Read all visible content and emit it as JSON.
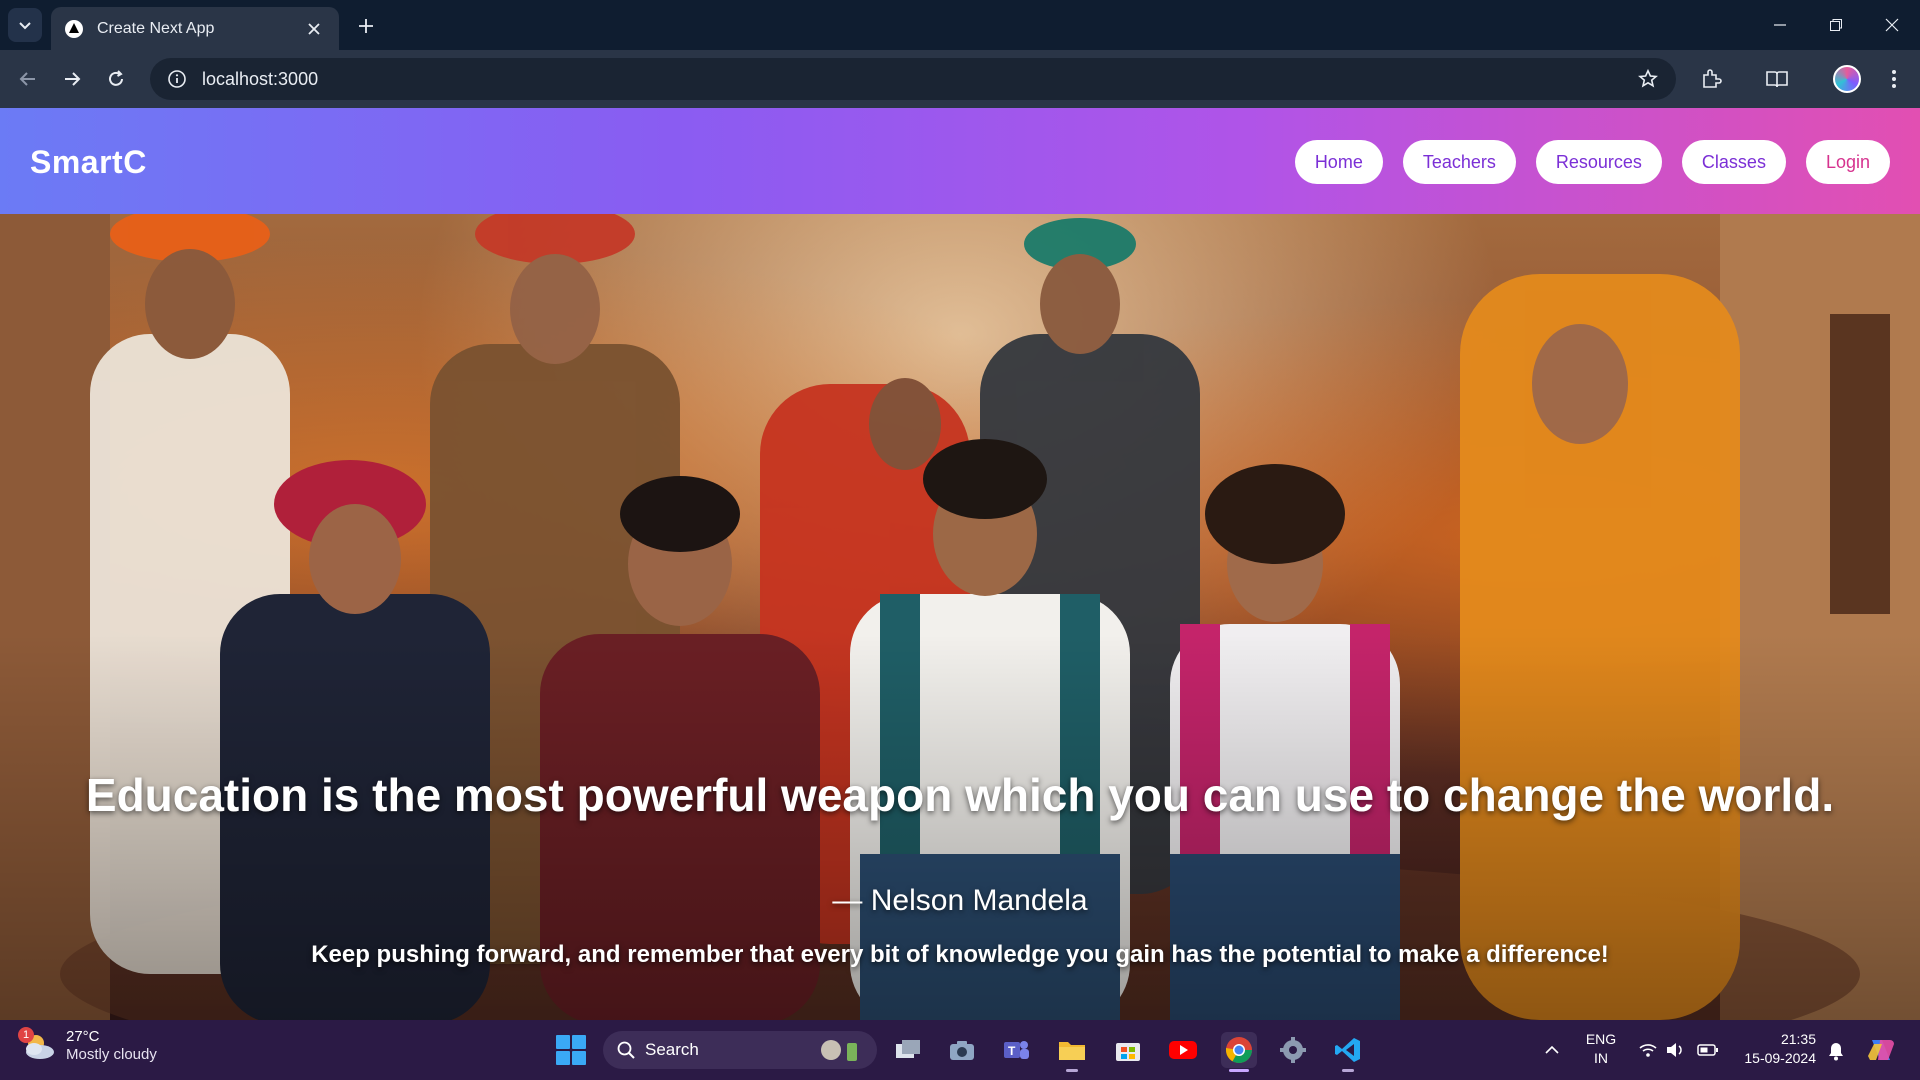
{
  "browser": {
    "tab_title": "Create Next App",
    "url": "localhost:3000"
  },
  "site": {
    "brand": "SmartC",
    "nav": [
      {
        "label": "Home"
      },
      {
        "label": "Teachers"
      },
      {
        "label": "Resources"
      },
      {
        "label": "Classes"
      },
      {
        "label": "Login"
      }
    ]
  },
  "hero": {
    "quote": "Education is the most powerful weapon which you can use to change the world.",
    "author": "— Nelson Mandela",
    "message": "Keep pushing forward, and remember that every bit of knowledge you gain has the potential to make a difference!"
  },
  "taskbar": {
    "weather_badge": "1",
    "weather_temp": "27°C",
    "weather_cond": "Mostly cloudy",
    "search_label": "Search",
    "lang_1": "ENG",
    "lang_2": "IN",
    "time": "21:35",
    "date": "15-09-2024"
  },
  "colors": {
    "nav_gradient_start": "#6b7bf5",
    "nav_gradient_end": "#e24fb2",
    "nav_link_text": "#7b2fd6",
    "taskbar_bg": "#2b1a45"
  }
}
